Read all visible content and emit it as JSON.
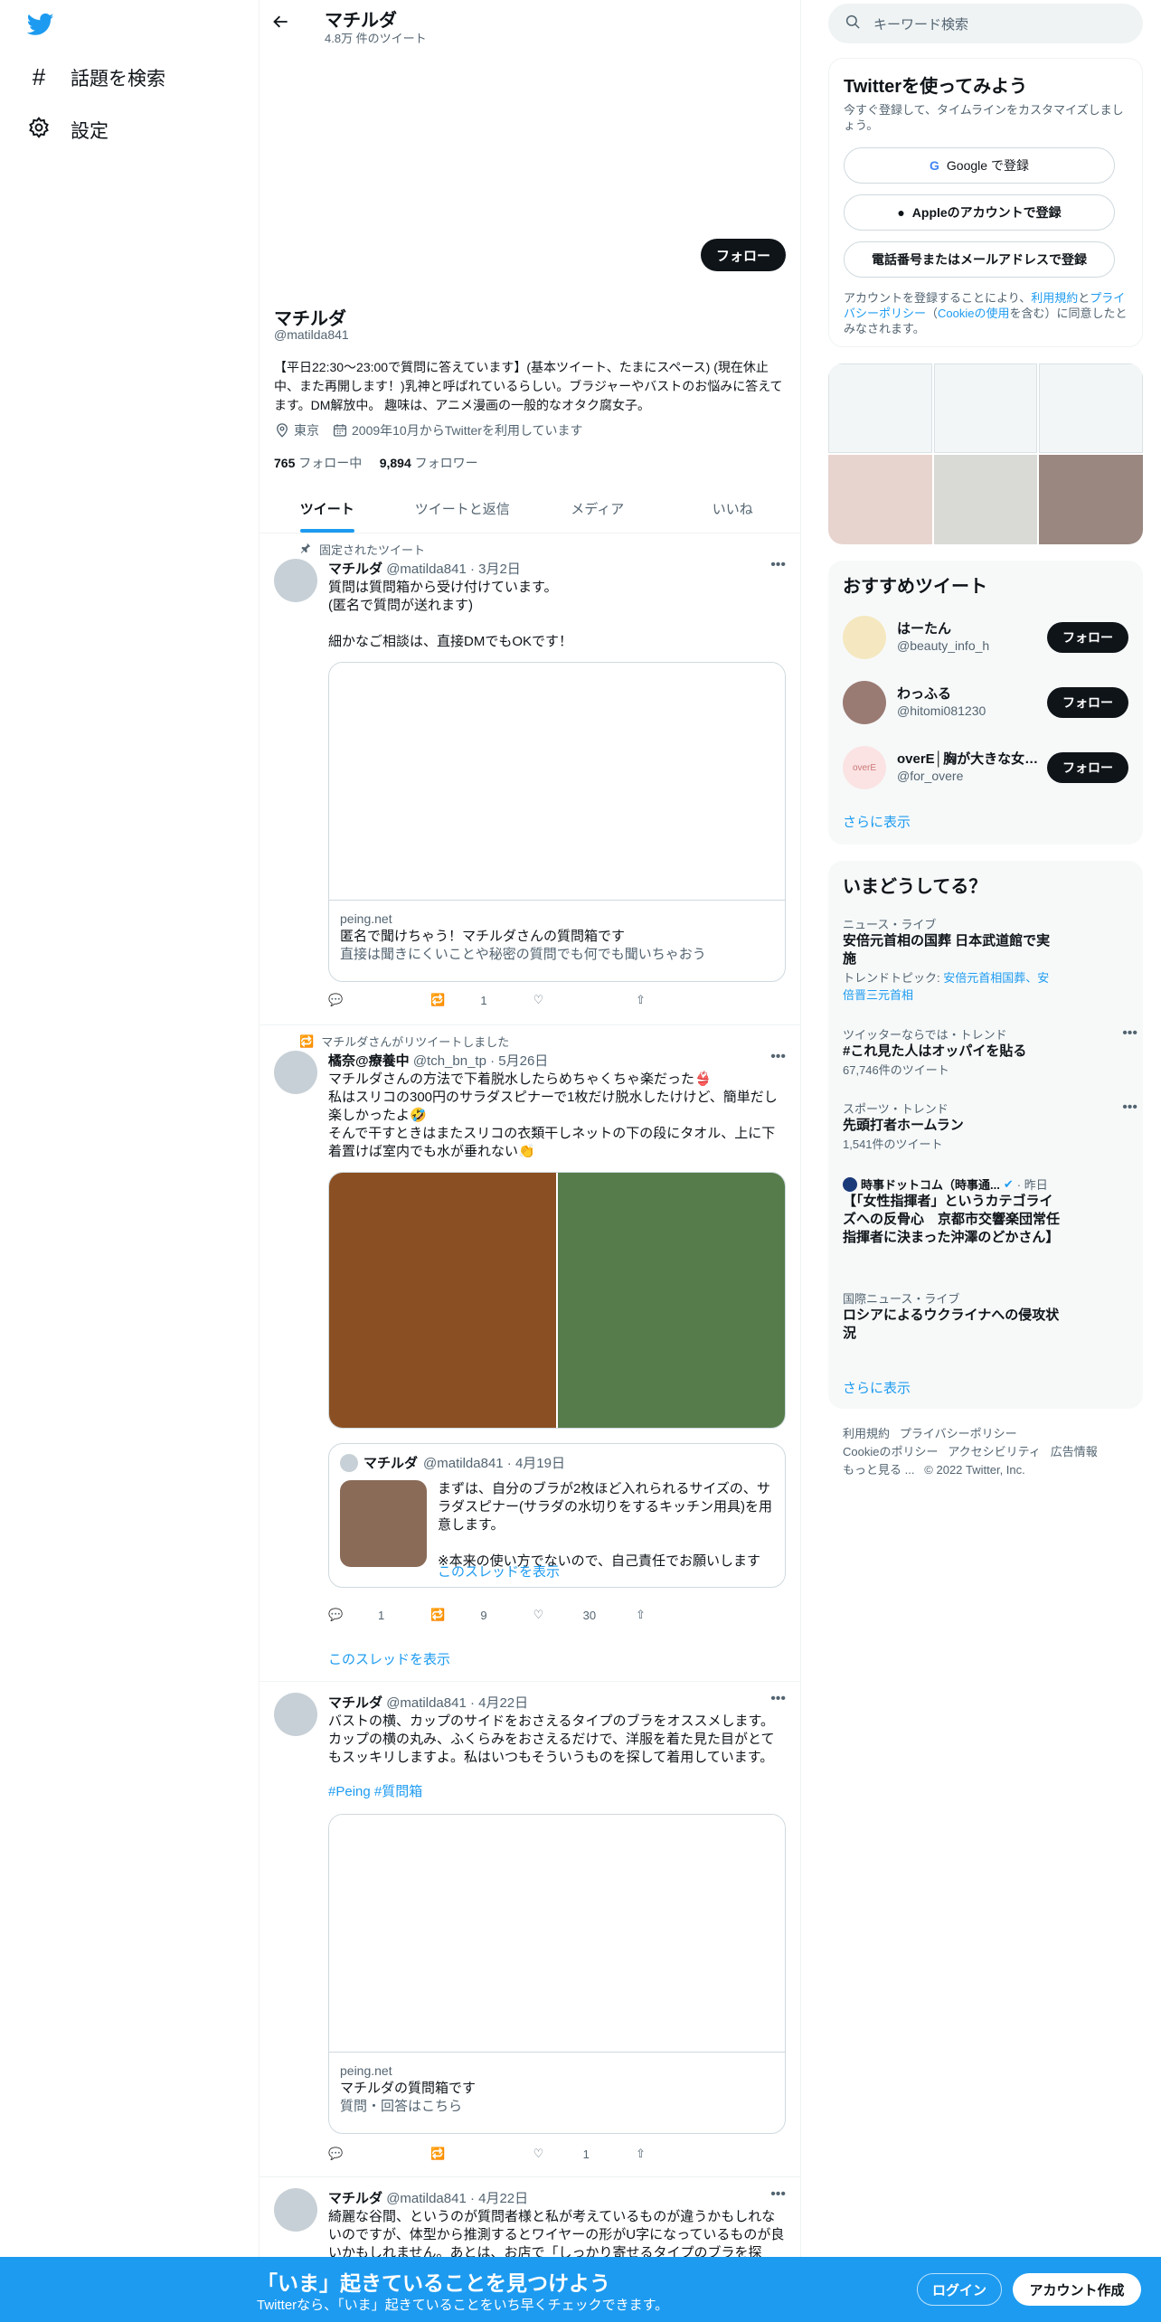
{
  "nav": {
    "explore": "話題を検索",
    "settings": "設定"
  },
  "header": {
    "title": "マチルダ",
    "tweet_count": "4.8万 件のツイート"
  },
  "profile": {
    "follow_label": "フォロー",
    "name": "マチルダ",
    "handle": "@matilda841",
    "bio": "【平日22:30〜23:00で質問に答えています】(基本ツイート、たまにスペース) (現在休止中、また再開します！)乳神と呼ばれているらしい。ブラジャーやバストのお悩みに答えてます。DM解放中。 趣味は、アニメ漫画の一般的なオタク腐女子。",
    "location": "東京",
    "joined": "2009年10月からTwitterを利用しています",
    "following_count": "765",
    "following_label": "フォロー中",
    "followers_count": "9,894",
    "followers_label": "フォロワー"
  },
  "tabs": [
    "ツイート",
    "ツイートと返信",
    "メディア",
    "いいね"
  ],
  "tweets": [
    {
      "context": "固定されたツイート",
      "name": "マチルダ",
      "meta": "@matilda841 · 3月2日",
      "text": "質問は質問箱から受け付けています。\n(匿名で質問が送れます)\n\n細かなご相談は、直接DMでもOKです！",
      "card": {
        "domain": "peing.net",
        "title": "匿名で聞けちゃう！マチルダさんの質問箱です",
        "desc": "直接は聞きにくいことや秘密の質問でも何でも聞いちゃおう"
      },
      "retweets": "1",
      "likes": "",
      "replies": ""
    },
    {
      "context": "マチルダさんがリツイートしました",
      "name": "橘奈@療養中",
      "meta": "@tch_bn_tp · 5月26日",
      "text": "マチルダさんの方法で下着脱水したらめちゃくちゃ楽だった👙\n私はスリコの300円のサラダスピナーで1枚だけ脱水したけけど、簡単だし楽しかったよ🤣\nそんで干すときはまたスリコの衣類干しネットの下の段にタオル、上に下着置けば室内でも水が垂れない👏",
      "quote": {
        "name": "マチルダ",
        "meta": "@matilda841 · 4月19日",
        "text": "まずは、自分のブラが2枚ほど入れられるサイズの、サラダスピナー(サラダの水切りをするキッチン用具)を用意します。\n\n※本来の使い方でないので、自己責任でお願いします",
        "link": "このスレッドを表示"
      },
      "replies": "1",
      "retweets": "9",
      "likes": "30",
      "show_thread": "このスレッドを表示"
    },
    {
      "name": "マチルダ",
      "meta": "@matilda841 · 4月22日",
      "text": "バストの横、カップのサイドをおさえるタイプのブラをオススメします。カップの横の丸み、ふくらみをおさえるだけで、洋服を着た見た目がとてもスッキリしますよ。私はいつもそういうものを探して着用しています。",
      "hashtags": "#Peing #質問箱",
      "card": {
        "domain": "peing.net",
        "title": "マチルダの質問箱です",
        "desc": "質問・回答はこちら"
      },
      "replies": "",
      "retweets": "",
      "likes": "1"
    },
    {
      "name": "マチルダ",
      "meta": "@matilda841 · 4月22日",
      "text": "綺麗な谷間、というのが質問者様と私が考えているものが違うかもしれないのですが、体型から推測するとワイヤーの形がU字になっているものが良いかもしれません。あとは、お店で「しっかり寄せるタイプのブラを探"
    }
  ],
  "right": {
    "search_placeholder": "キーワード検索",
    "signup": {
      "title": "Twitterを使ってみよう",
      "subtitle": "今すぐ登録して、タイムラインをカスタマイズしましょう。",
      "google": "Google で登録",
      "apple": "Appleのアカウントで登録",
      "phone": "電話番号またはメールアドレスで登録",
      "terms_pre": "アカウントを登録することにより、",
      "terms_link1": "利用規約",
      "terms_mid": "と",
      "terms_link2": "プライバシーポリシー",
      "terms_paren_open": "（",
      "terms_link3": "Cookieの使用",
      "terms_post": "を含む）に同意したとみなされます。"
    },
    "recommended": {
      "title": "おすすめツイート",
      "users": [
        {
          "name": "はーたん",
          "handle": "@beauty_info_h",
          "button": "フォロー"
        },
        {
          "name": "わっふる",
          "handle": "@hitomi081230",
          "button": "フォロー"
        },
        {
          "name": "overE│胸が大きな女性向け",
          "handle": "@for_overe",
          "button": "フォロー"
        }
      ],
      "avatar3_text": "overE",
      "more": "さらに表示"
    },
    "trends": {
      "title": "いまどうしてる？",
      "items": [
        {
          "context": "ニュース・ライブ",
          "title": "安倍元首相の国葬 日本武道館で実施",
          "extra_label": "トレンドトピック: ",
          "extra": "安倍元首相国葬、安倍晋三元首相"
        },
        {
          "context": "ツイッターならでは・トレンド",
          "title": "#これ見た人はオッパイを貼る",
          "count": "67,746件のツイート"
        },
        {
          "context": "スポーツ・トレンド",
          "title": "先頭打者ホームラン",
          "count": "1,541件のツイート"
        },
        {
          "source": "時事ドットコム（時事通...",
          "time": "· 昨日",
          "title": "【「女性指揮者」というカテゴライズへの反骨心　京都市交響楽団常任指揮者に決まった沖澤のどかさん】"
        },
        {
          "context": "国際ニュース・ライブ",
          "title": "ロシアによるウクライナへの侵攻状況"
        }
      ],
      "more": "さらに表示"
    },
    "footer": [
      "利用規約",
      "プライバシーポリシー",
      "Cookieのポリシー",
      "アクセシビリティ",
      "広告情報",
      "もっと見る ...",
      "© 2022 Twitter, Inc."
    ]
  },
  "bottom": {
    "title": "「いま」起きていることを見つけよう",
    "subtitle": "Twitterなら、「いま」起きていることをいち早くチェックできます。",
    "login": "ログイン",
    "signup": "アカウント作成"
  },
  "colors": {
    "accent": "#1d9bf0",
    "dark": "#0f1419",
    "muted": "#536471",
    "media1": "#8a4f22",
    "media2": "#557c4a",
    "quote_thumb": "#8a6b58"
  }
}
